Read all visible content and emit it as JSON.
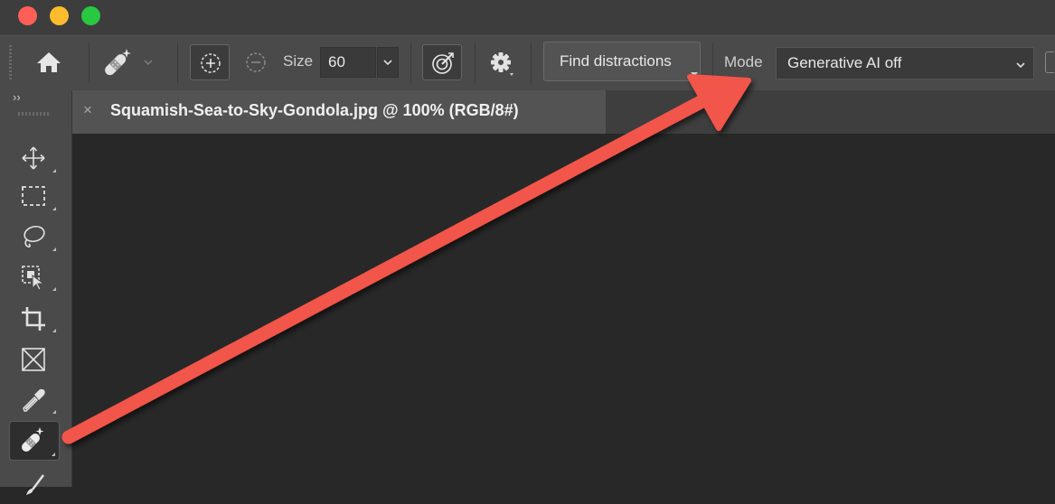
{
  "window": {
    "traffic_lights": {
      "close": "#ff5f57",
      "minimize": "#febc2e",
      "zoom": "#28c840"
    }
  },
  "options_bar": {
    "home_icon": "home-icon",
    "tool_preset_icon": "bandage-sparkle-icon",
    "add_icon": "circle-plus-icon",
    "subtract_icon": "circle-minus-icon",
    "size_label": "Size",
    "size_value": "60",
    "pressure_icon": "pressure-target-icon",
    "settings_icon": "gear-icon",
    "find_distractions_label": "Find distractions",
    "mode_label": "Mode",
    "mode_value": "Generative AI off"
  },
  "tab_bar": {
    "collapse_glyph": "››",
    "close_glyph": "×",
    "document_title": "Squamish-Sea-to-Sky-Gondola.jpg @ 100% (RGB/8#)"
  },
  "toolbar": {
    "tools": [
      {
        "name": "move-tool",
        "icon": "move-icon"
      },
      {
        "name": "marquee-tool",
        "icon": "rect-marquee-icon"
      },
      {
        "name": "lasso-tool",
        "icon": "lasso-icon"
      },
      {
        "name": "object-select-tool",
        "icon": "object-select-icon"
      },
      {
        "name": "crop-tool",
        "icon": "crop-icon"
      },
      {
        "name": "frame-tool",
        "icon": "frame-icon"
      },
      {
        "name": "eyedropper-tool",
        "icon": "eyedropper-icon"
      },
      {
        "name": "remove-tool",
        "icon": "bandage-sparkle-icon",
        "active": true
      },
      {
        "name": "brush-tool",
        "icon": "brush-icon"
      }
    ]
  },
  "annotation": {
    "arrow_color": "#f2544a"
  }
}
